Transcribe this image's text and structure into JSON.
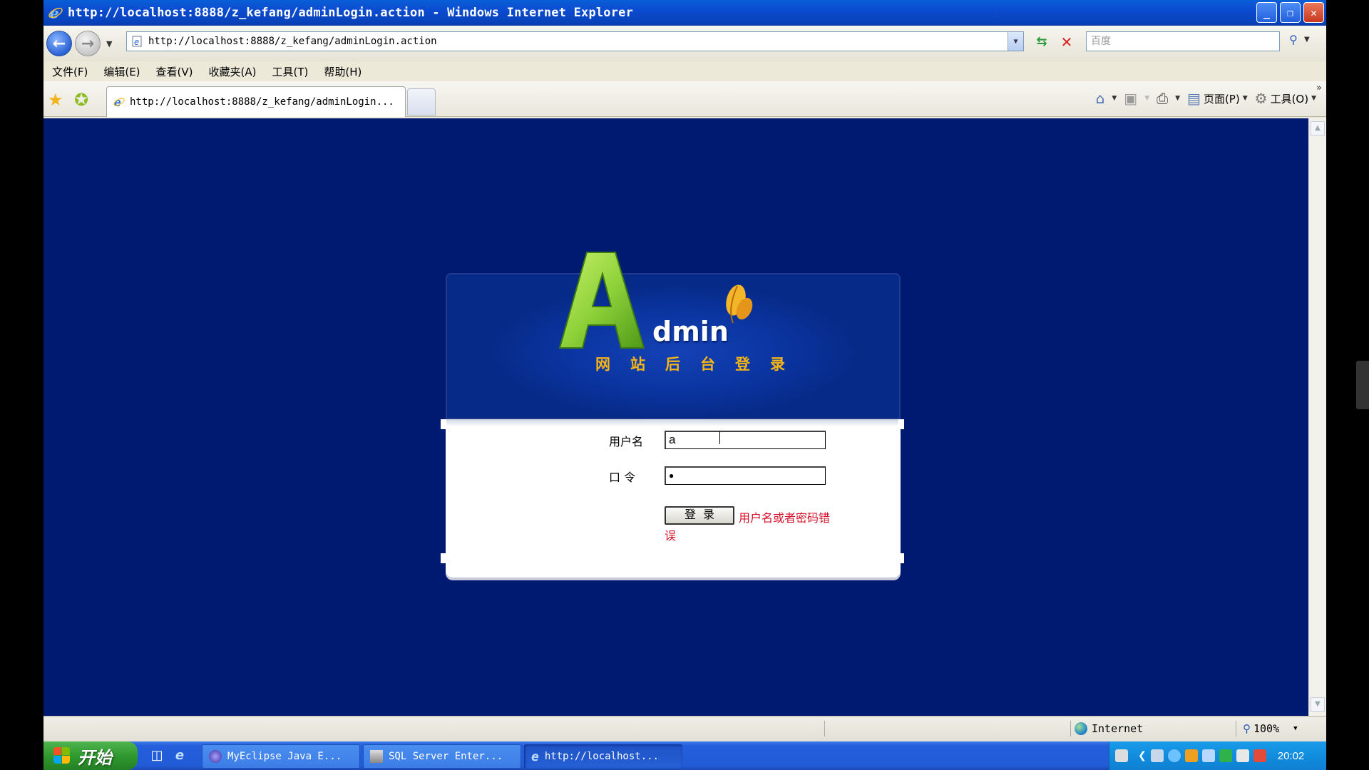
{
  "window": {
    "title": "http://localhost:8888/z_kefang/adminLogin.action - Windows Internet Explorer",
    "minimize": "_",
    "maximize": "❐",
    "close": "✕"
  },
  "address_bar": {
    "url": "http://localhost:8888/z_kefang/adminLogin.action",
    "search_placeholder": "百度"
  },
  "menu": {
    "items": [
      "文件(F)",
      "编辑(E)",
      "查看(V)",
      "收藏夹(A)",
      "工具(T)",
      "帮助(H)"
    ]
  },
  "tab": {
    "label": "http://localhost:8888/z_kefang/adminLogin..."
  },
  "command_bar": {
    "page": "页面(P)",
    "tools": "工具(O)"
  },
  "login": {
    "logo_letter": "A",
    "logo_rest": "dmin",
    "subtitle": "网站后台登录",
    "username_label": "用户名",
    "username_value": "a",
    "password_label": "口 令",
    "password_value": "●",
    "submit_label": "登录",
    "error_message": "用户名或者密码错误"
  },
  "status_bar": {
    "zone": "Internet",
    "zoom": "100%"
  },
  "taskbar": {
    "start_label": "开始",
    "tasks": [
      {
        "label": "MyEclipse Java E...",
        "icon": "eclipse-icon"
      },
      {
        "label": "SQL Server Enter...",
        "icon": "sqlserver-icon"
      },
      {
        "label": "http://localhost...",
        "icon": "ie-icon"
      }
    ],
    "clock": "20:02"
  },
  "colors": {
    "page_background": "#001a72",
    "banner_blue": "#0b35a2",
    "logo_green": "#8fd23a",
    "subtitle_gold": "#f5b416",
    "error_red": "#d6102a"
  }
}
